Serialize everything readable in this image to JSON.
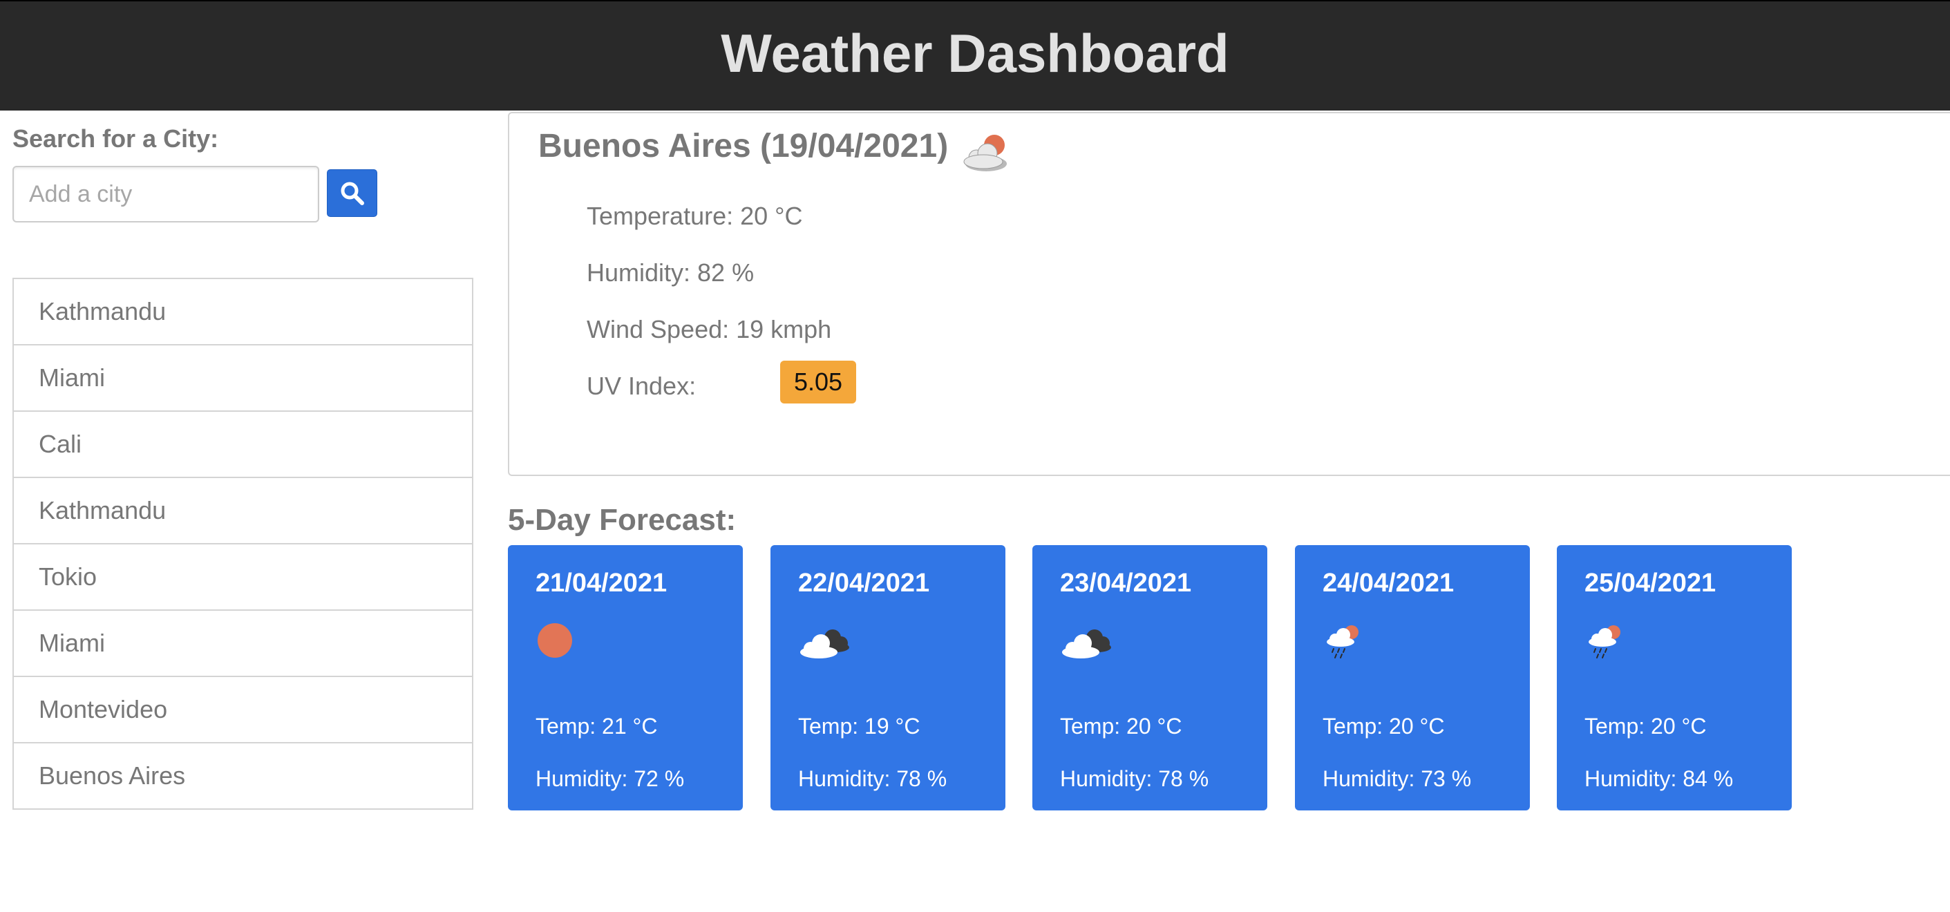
{
  "header": {
    "title": "Weather Dashboard"
  },
  "search": {
    "label": "Search for a City:",
    "placeholder": "Add a city",
    "button_icon": "search-icon"
  },
  "history": [
    {
      "label": "Kathmandu"
    },
    {
      "label": "Miami"
    },
    {
      "label": "Cali"
    },
    {
      "label": "Kathmandu"
    },
    {
      "label": "Tokio"
    },
    {
      "label": "Miami"
    },
    {
      "label": "Montevideo"
    },
    {
      "label": "Buenos Aires"
    }
  ],
  "current": {
    "title": "Buenos Aires (19/04/2021)",
    "icon": "partly-cloudy-day-icon",
    "temperature": "Temperature: 20 °C",
    "humidity": "Humidity: 82 %",
    "wind": "Wind Speed: 19 kmph",
    "uv_label": "UV Index:",
    "uv_value": "5.05",
    "uv_color": "#f4a73a"
  },
  "forecast": {
    "heading": "5-Day Forecast:",
    "days": [
      {
        "date": "21/04/2021",
        "icon": "clear-sun-icon",
        "temp": "Temp: 21 °C",
        "humidity": "Humidity: 72 %"
      },
      {
        "date": "22/04/2021",
        "icon": "broken-clouds-icon",
        "temp": "Temp: 19 °C",
        "humidity": "Humidity: 78 %"
      },
      {
        "date": "23/04/2021",
        "icon": "broken-clouds-icon",
        "temp": "Temp: 20 °C",
        "humidity": "Humidity: 78 %"
      },
      {
        "date": "24/04/2021",
        "icon": "light-rain-sun-icon",
        "temp": "Temp: 20 °C",
        "humidity": "Humidity: 73 %"
      },
      {
        "date": "25/04/2021",
        "icon": "light-rain-sun-icon",
        "temp": "Temp: 20 °C",
        "humidity": "Humidity: 84 %"
      }
    ]
  },
  "colors": {
    "header_bg": "#292929",
    "accent": "#2b6fd9",
    "card_bg": "#3176e6",
    "uv_moderate": "#f4a73a"
  }
}
